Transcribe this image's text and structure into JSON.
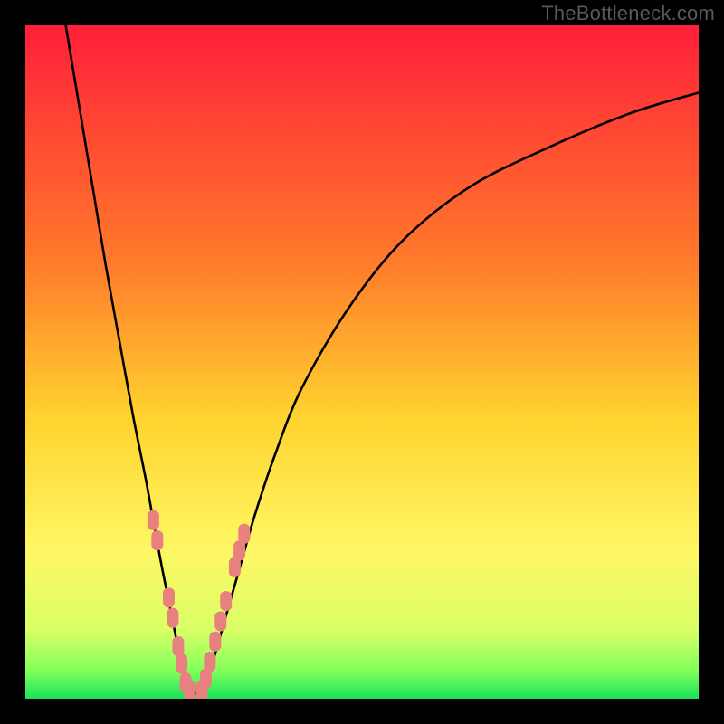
{
  "watermark": "TheBottleneck.com",
  "chart_data": {
    "type": "line",
    "title": "",
    "xlabel": "",
    "ylabel": "",
    "xlim": [
      0,
      100
    ],
    "ylim": [
      0,
      100
    ],
    "grid": false,
    "legend": false,
    "annotations": [
      "background gradient red→orange→yellow→green (top→bottom)",
      "V-shaped black curve"
    ],
    "series": [
      {
        "name": "bottleneck-curve",
        "x": [
          6,
          8,
          10,
          12,
          14,
          16,
          18,
          20,
          22,
          23,
          24,
          25,
          26,
          27,
          28,
          30,
          32,
          34,
          37,
          41,
          48,
          56,
          66,
          78,
          90,
          100
        ],
        "y": [
          100,
          88,
          76,
          64,
          53,
          42,
          32,
          21,
          11,
          6,
          3,
          1,
          1,
          3,
          6,
          13,
          20,
          27,
          36,
          46,
          58,
          68,
          76,
          82,
          87,
          90
        ]
      },
      {
        "name": "left-marker-cluster",
        "type": "scatter",
        "x": [
          19.0,
          19.6,
          21.3,
          21.9,
          22.7,
          23.2,
          23.8,
          24.4
        ],
        "y": [
          26.5,
          23.5,
          15.0,
          12.0,
          7.8,
          5.2,
          2.4,
          1.2
        ]
      },
      {
        "name": "right-marker-cluster",
        "type": "scatter",
        "x": [
          26.2,
          26.8,
          27.4,
          28.2,
          29.0,
          29.8,
          31.1,
          31.8,
          32.5
        ],
        "y": [
          1.2,
          3.0,
          5.5,
          8.5,
          11.5,
          14.5,
          19.5,
          22.0,
          24.5
        ]
      }
    ],
    "background_gradient_stops": [
      {
        "offset": 0,
        "color": "#ff1f3a"
      },
      {
        "offset": 35,
        "color": "#ff7a2b"
      },
      {
        "offset": 58,
        "color": "#ffd22e"
      },
      {
        "offset": 78,
        "color": "#fff765"
      },
      {
        "offset": 90,
        "color": "#d8ff66"
      },
      {
        "offset": 96,
        "color": "#7fff5a"
      },
      {
        "offset": 100,
        "color": "#18e35a"
      }
    ],
    "marker_color": "#e98080"
  }
}
